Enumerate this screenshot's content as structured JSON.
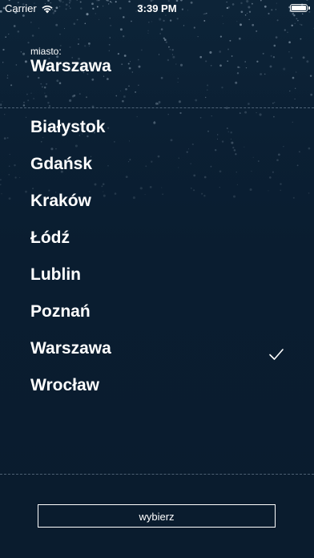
{
  "status_bar": {
    "carrier": "Carrier",
    "time": "3:39 PM",
    "wifi_icon": "wifi-icon",
    "battery_icon": "battery-icon",
    "battery_level": 1.0
  },
  "header": {
    "label": "miasto:",
    "current_city": "Warszawa"
  },
  "cities": [
    {
      "name": "Białystok",
      "selected": false
    },
    {
      "name": "Gdańsk",
      "selected": false
    },
    {
      "name": "Kraków",
      "selected": false
    },
    {
      "name": "Łódź",
      "selected": false
    },
    {
      "name": "Lublin",
      "selected": false
    },
    {
      "name": "Poznań",
      "selected": false
    },
    {
      "name": "Warszawa",
      "selected": true
    },
    {
      "name": "Wrocław",
      "selected": false
    }
  ],
  "select_button": {
    "label": "wybierz"
  },
  "colors": {
    "background": "#0b1e31",
    "text": "#ffffff",
    "divider": "#a0b4c8"
  }
}
